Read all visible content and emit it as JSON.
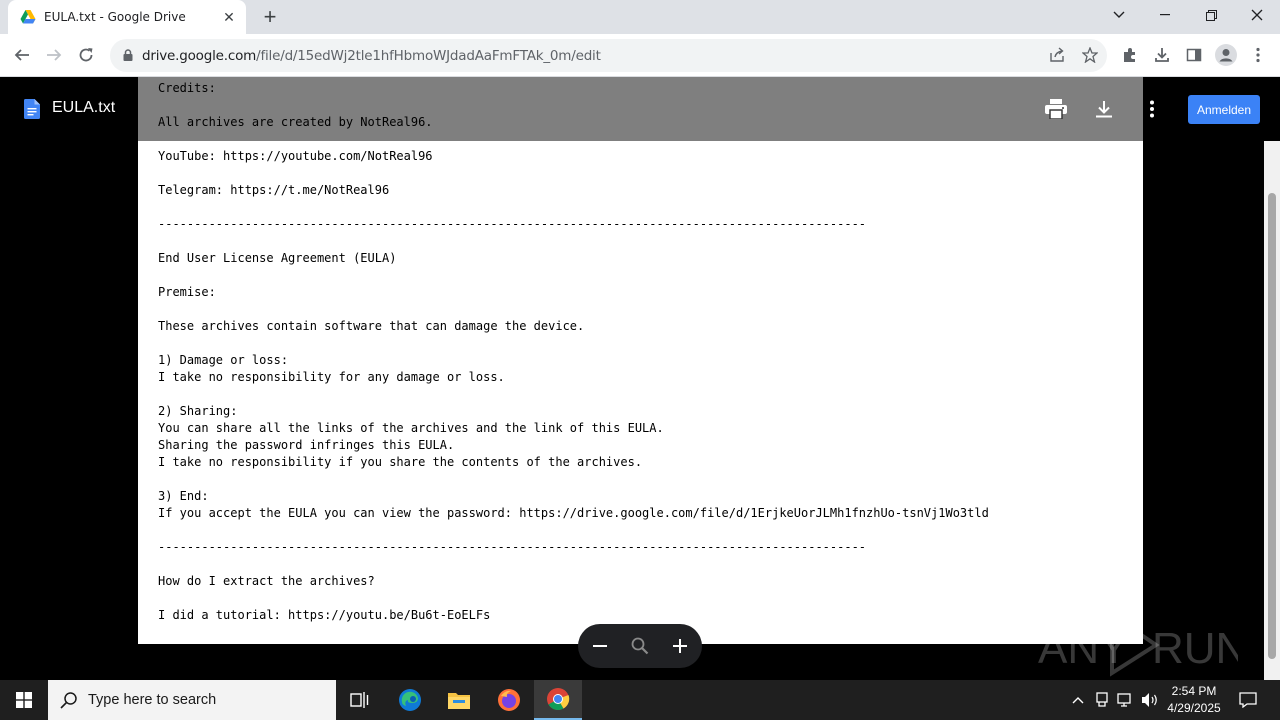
{
  "browser": {
    "tab": {
      "title": "EULA.txt - Google Drive",
      "favicon": "google-drive-icon"
    },
    "url_domain": "drive.google.com",
    "url_path": "/file/d/15edWj2tle1hfHbmoWJdadAaFmFTAk_0m/edit",
    "colors": {
      "tabstrip": "#dee1e6",
      "toolbar": "#ffffff",
      "omnibox": "#f1f3f4"
    }
  },
  "drive": {
    "file_name": "EULA.txt",
    "signin_label": "Anmelden",
    "accent": "#3b82f6",
    "document_text": "Credits:\n\nAll archives are created by NotReal96.\n\nYouTube: https://youtube.com/NotReal96\n\nTelegram: https://t.me/NotReal96\n\n--------------------------------------------------------------------------------------------------\n\nEnd User License Agreement (EULA)\n\nPremise:\n\nThese archives contain software that can damage the device.\n\n1) Damage or loss:\nI take no responsibility for any damage or loss.\n\n2) Sharing:\nYou can share all the links of the archives and the link of this EULA.\nSharing the password infringes this EULA.\nI take no responsibility if you share the contents of the archives.\n\n3) End:\nIf you accept the EULA you can view the password: https://drive.google.com/file/d/1ErjkeUorJLMh1fnzhUo-tsnVj1Wo3tld\n\n--------------------------------------------------------------------------------------------------\n\nHow do I extract the archives?\n\nI did a tutorial: https://youtu.be/Bu6t-EoELFs"
  },
  "watermark": {
    "left": "ANY",
    "right": "RUN"
  },
  "taskbar": {
    "search_placeholder": "Type here to search",
    "time": "2:54 PM",
    "date": "4/29/2025"
  }
}
